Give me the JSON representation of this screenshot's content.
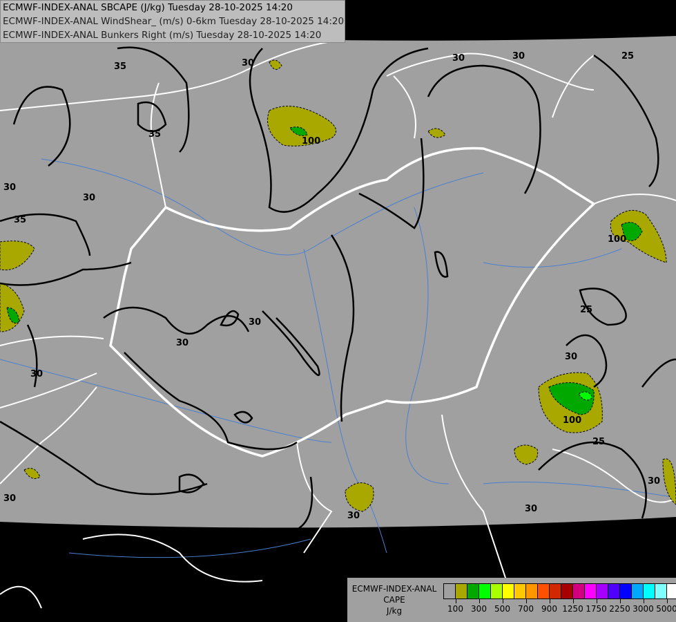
{
  "header": {
    "lines": [
      "ECMWF-INDEX-ANAL SBCAPE (J/kg) Tuesday 28-10-2025 14:20",
      "ECMWF-INDEX-ANAL WindShear_ (m/s) 0-6km Tuesday 28-10-2025 14:20",
      "ECMWF-INDEX-ANAL Bunkers Right (m/s) Tuesday 28-10-2025 14:20"
    ]
  },
  "map": {
    "colors": {
      "background": "#000000",
      "domain": "#a0a0a0",
      "borders": "#ffffff",
      "rivers": "#4a7fd0",
      "contours": "#000000"
    },
    "contour_labels": [
      "35",
      "30",
      "30",
      "30",
      "35",
      "30",
      "35",
      "25",
      "30",
      "30",
      "30",
      "25",
      "30",
      "25",
      "30",
      "30",
      "30",
      "30",
      "30",
      "100",
      "100",
      "100"
    ]
  },
  "legend": {
    "title_lines": [
      "ECMWF-INDEX-ANAL",
      "CAPE",
      "J/kg"
    ],
    "colors": [
      "#a0a0a0",
      "#a8a800",
      "#00a800",
      "#00ff00",
      "#a8ff00",
      "#ffff00",
      "#ffc800",
      "#ff9600",
      "#ff5000",
      "#d22800",
      "#a80000",
      "#d2007e",
      "#ff00ff",
      "#a800ff",
      "#5000ff",
      "#0000ff",
      "#00a8ff",
      "#00ffff",
      "#80ffff",
      "#ffffff"
    ],
    "labels": [
      "100",
      "300",
      "500",
      "700",
      "900",
      "1250",
      "1750",
      "2250",
      "3000",
      "5000"
    ]
  }
}
